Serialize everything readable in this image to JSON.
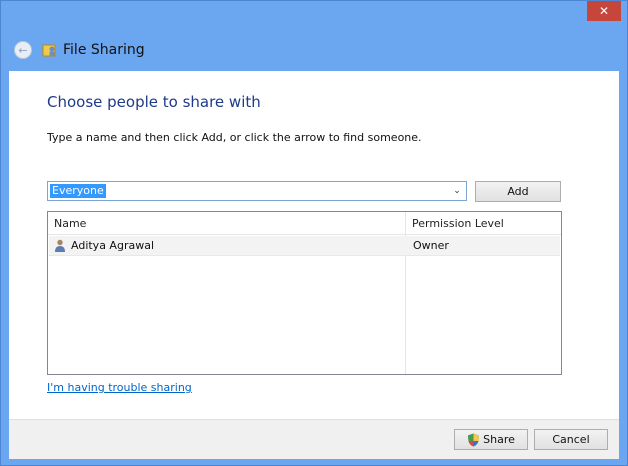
{
  "window": {
    "title": "File Sharing",
    "close_glyph": "✕"
  },
  "header": {
    "back_icon": "back-arrow-icon",
    "app_icon": "file-sharing-icon"
  },
  "main": {
    "heading": "Choose people to share with",
    "instruction": "Type a name and then click Add, or click the arrow to find someone.",
    "combo": {
      "value": "Everyone",
      "arrow_glyph": "⌄"
    },
    "add_label": "Add",
    "list": {
      "columns": [
        "Name",
        "Permission Level"
      ],
      "rows": [
        {
          "name": "Aditya Agrawal",
          "permission": "Owner",
          "icon": "user-icon"
        }
      ]
    },
    "help_link": "I'm having trouble sharing"
  },
  "footer": {
    "share_label": "Share",
    "cancel_label": "Cancel",
    "share_icon": "uac-shield-icon"
  },
  "colors": {
    "title_bar": "#6ba7f0",
    "heading": "#1e3a8a",
    "link": "#0066cc",
    "selection": "#3399ff"
  }
}
